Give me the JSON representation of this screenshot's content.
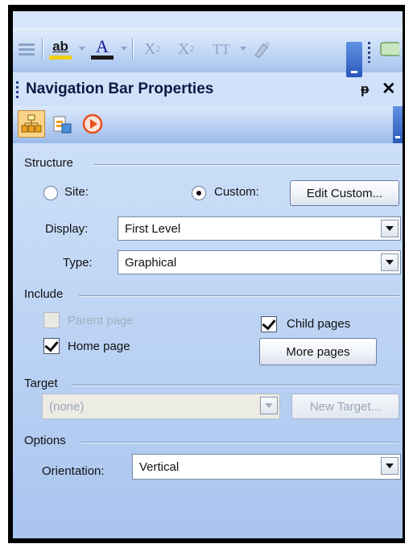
{
  "panel": {
    "title": "Navigation Bar Properties",
    "pin_glyph": "ᵽ",
    "close_glyph": "✕"
  },
  "toolbar": {
    "highlight_label": "ab",
    "font_color_label": "A",
    "subscript_label": "X",
    "subscript_sub": "2",
    "superscript_label": "X",
    "superscript_sup": "2",
    "tt_label": "TT",
    "colors": {
      "highlight": "#f0d000",
      "font": "#1a1a1a"
    }
  },
  "structure": {
    "label": "Structure",
    "site_label": "Site:",
    "custom_label": "Custom:",
    "edit_custom_label": "Edit Custom...",
    "selected": "custom",
    "display_label": "Display:",
    "display_value": "First Level",
    "type_label": "Type:",
    "type_value": "Graphical"
  },
  "include": {
    "label": "Include",
    "parent_page_label": "Parent page",
    "parent_page_checked": false,
    "home_page_label": "Home page",
    "home_page_checked": true,
    "child_pages_label": "Child pages",
    "child_pages_checked": true,
    "more_pages_label": "More pages"
  },
  "target": {
    "label": "Target",
    "value": "(none)",
    "new_target_label": "New Target..."
  },
  "options": {
    "label": "Options",
    "orientation_label": "Orientation:",
    "orientation_value": "Vertical"
  }
}
